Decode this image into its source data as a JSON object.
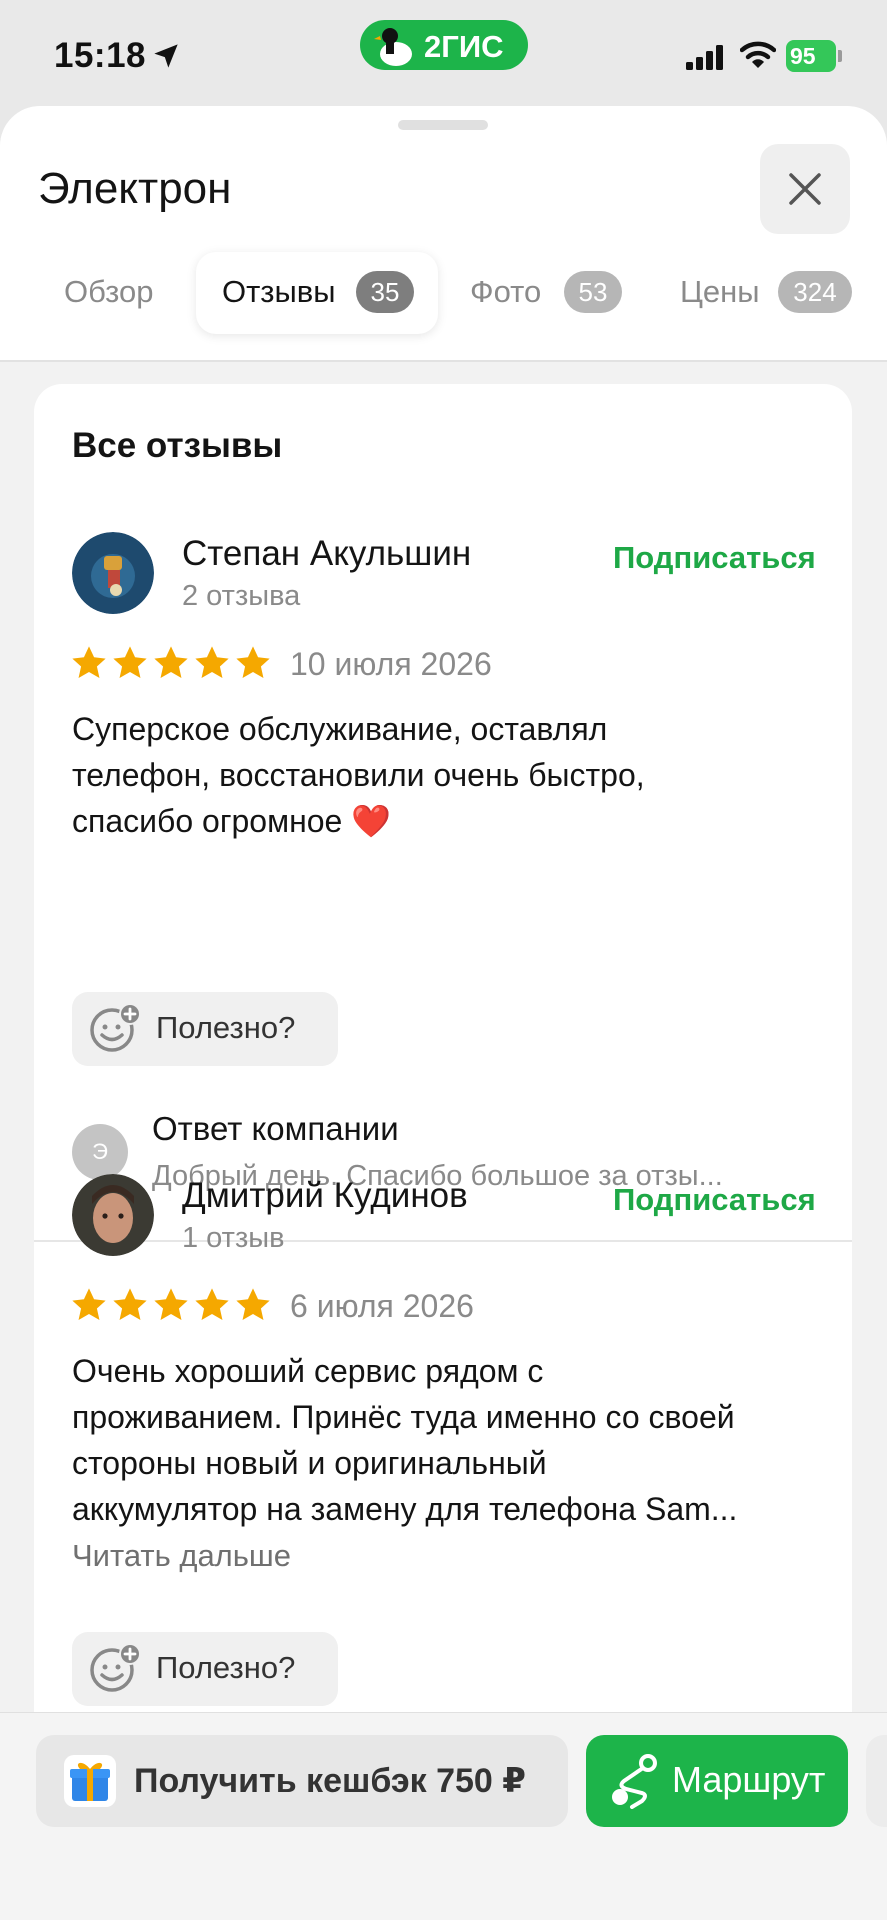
{
  "status_bar": {
    "time": "15:18",
    "app_badge": "2ГИС",
    "battery": "95"
  },
  "sheet": {
    "title": "Электрон",
    "tabs": [
      {
        "label": "Обзор",
        "count": ""
      },
      {
        "label": "Отзывы",
        "count": "35"
      },
      {
        "label": "Фото",
        "count": "53"
      },
      {
        "label": "Цены",
        "count": "324"
      }
    ],
    "active_tab": "Отзывы"
  },
  "reviews_section": {
    "heading": "Все отзывы",
    "reviews": [
      {
        "name": "Степан Акульшин",
        "count": "2 отзыва",
        "subscribe": "Подписаться",
        "rating": 5,
        "date": "10 июля 2026",
        "text_line1": "Суперское обслуживание, оставлял",
        "text_line2": "телефон, восстановили очень быстро,",
        "text_line3": "спасибо огромное ",
        "emoji": "❤️",
        "useful": "Полезно?",
        "reply_avatar": "Э",
        "reply_title": "Ответ компании",
        "reply_text": "Добрый день. Спасибо большое за отзы..."
      },
      {
        "name": "Дмитрий Кудинов",
        "count": "1 отзыв",
        "subscribe": "Подписаться",
        "rating": 5,
        "date": "6 июля 2026",
        "text_line1": "Очень хороший сервис рядом с",
        "text_line2": "проживанием. Принёс туда именно со своей",
        "text_line3": "стороны новый и оригинальный",
        "text_line4": "аккумулятор на замену для телефона Sam...",
        "read_more": "Читать дальше",
        "useful": "Полезно?"
      }
    ]
  },
  "bottom_bar": {
    "cashback": "Получить кешбэк 750 ₽",
    "route": "Маршрут"
  },
  "colors": {
    "accent_green": "#1db44a",
    "star": "#f5a800",
    "subscribe": "#1ea846"
  }
}
